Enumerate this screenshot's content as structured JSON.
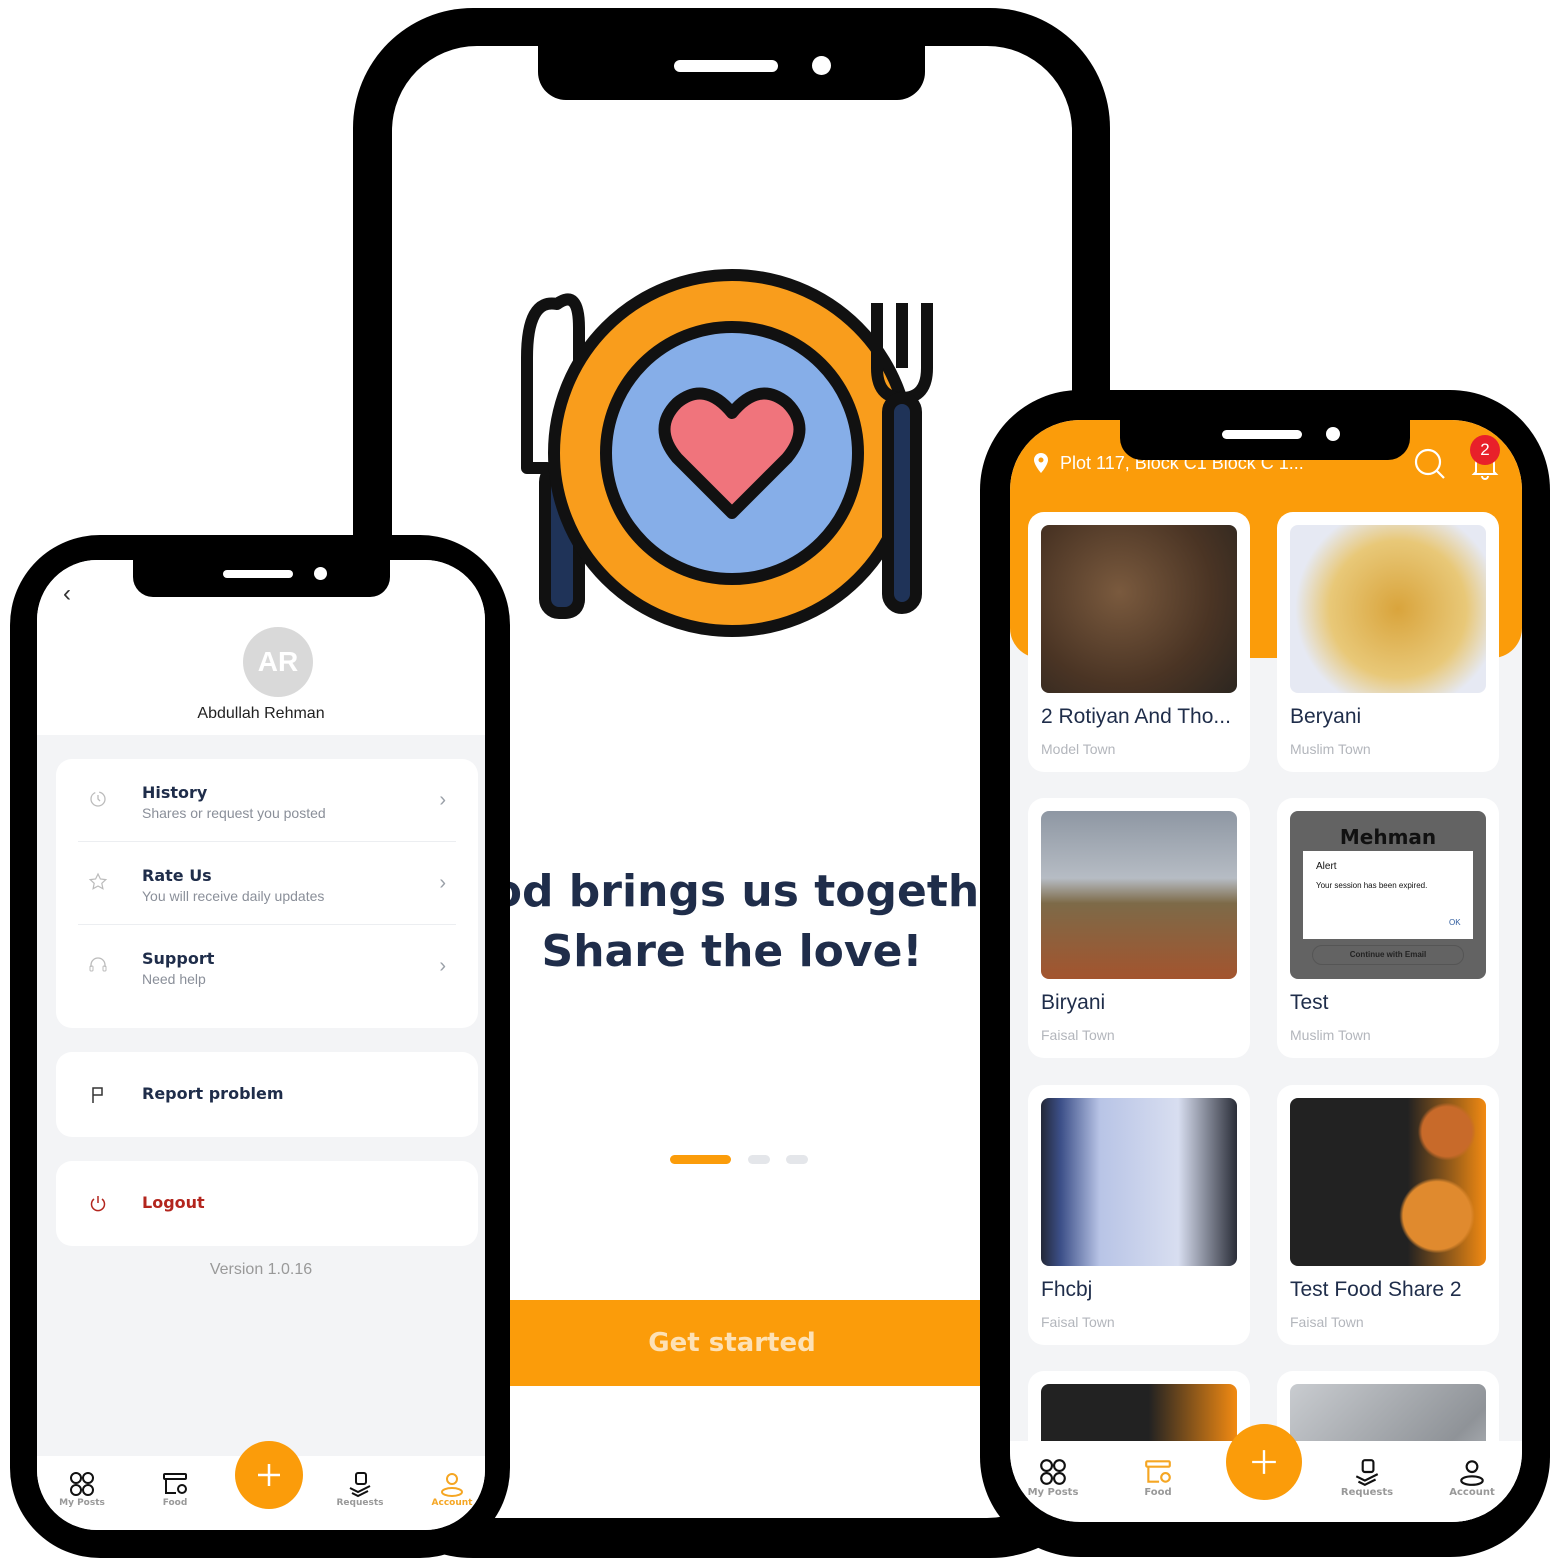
{
  "onboarding": {
    "tagline_line1": "Food brings us together",
    "tagline_line2": "Share the love!",
    "page_indicator": {
      "total": 3,
      "active": 1
    },
    "get_started_label": "Get started",
    "logo_icon": "plate-heart-fork-knife-logo"
  },
  "account": {
    "avatar_initials": "AR",
    "user_name": "Abdullah Rehman",
    "menu": [
      {
        "title": "History",
        "subtitle": "Shares or request you posted",
        "icon": "clock-icon"
      },
      {
        "title": "Rate Us",
        "subtitle": "You will receive daily updates",
        "icon": "star-icon"
      },
      {
        "title": "Support",
        "subtitle": "Need help",
        "icon": "headset-icon"
      }
    ],
    "report_label": "Report problem",
    "logout_label": "Logout",
    "version": "Version 1.0.16",
    "active_tab": "Account"
  },
  "nav": {
    "my_posts": "My Posts",
    "food": "Food",
    "requests": "Requests",
    "account": "Account"
  },
  "feed": {
    "location": "Plot 117, Block C1 Block C 1...",
    "notification_count": "2",
    "active_tab": "Food",
    "items": [
      {
        "title": "2 Rotiyan And Tho...",
        "location": "Model Town"
      },
      {
        "title": "Beryani",
        "location": "Muslim Town"
      },
      {
        "title": "Biryani",
        "location": "Faisal Town"
      },
      {
        "title": "Test",
        "location": "Muslim Town"
      },
      {
        "title": "Fhcbj",
        "location": "Faisal Town"
      },
      {
        "title": "Test Food Share 2",
        "location": "Faisal Town"
      }
    ],
    "test_image": {
      "heading": "Mehman",
      "alert_title": "Alert",
      "alert_message": "Your session has been expired.",
      "alert_ok": "OK",
      "continue_label": "Continue with Email"
    }
  },
  "colors": {
    "accent": "#fb9c0a",
    "navy": "#1f2d4a",
    "logout": "#b3261e",
    "badge": "#e8202a",
    "plate_blue": "#86aee8",
    "heart": "#f0747c"
  }
}
